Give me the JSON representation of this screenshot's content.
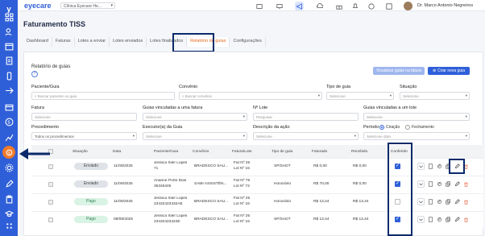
{
  "app": {
    "logo": "eyecare",
    "clinic": "Clínica Eyecare He...",
    "user": "Dr. Marco Antonio Negreiros"
  },
  "page": {
    "title": "Faturamento TISS"
  },
  "tabs": [
    {
      "label": "Dashboard"
    },
    {
      "label": "Faturas"
    },
    {
      "label": "Lotes a enviar"
    },
    {
      "label": "Lotes enviados"
    },
    {
      "label": "Lotes finalizados"
    },
    {
      "label": "Relatório de guias"
    },
    {
      "label": "Configurações"
    }
  ],
  "report": {
    "section_title": "Relatório de guias",
    "btn_view": "Visualizar guias na fatura",
    "btn_create": "Criar nova guia"
  },
  "filters": {
    "paciente": {
      "label": "Paciente/Guia",
      "placeholder": "Buscar paciente ou guia"
    },
    "convenio": {
      "label": "Convênio",
      "placeholder": "Buscar convênio"
    },
    "tipo": {
      "label": "Tipo de guia",
      "placeholder": "Selecione"
    },
    "situacao": {
      "label": "Situação",
      "placeholder": "Selecione"
    },
    "fatura": {
      "label": "Fatura",
      "placeholder": "Selecione"
    },
    "guias_fatura": {
      "label": "Guias vinculadas a uma fatura",
      "placeholder": "Selecione"
    },
    "lote": {
      "label": "Nº Lote",
      "placeholder": "Pesquisar"
    },
    "guias_lote": {
      "label": "Guias vinculadas a um lote",
      "placeholder": "Selecione"
    },
    "procedimento": {
      "label": "Procedimento",
      "placeholder": "Todos os procedimentos"
    },
    "executor": {
      "label": "Executor(a) da Guia",
      "placeholder": "Selecione"
    },
    "descricao": {
      "label": "Descrição da ação",
      "placeholder": "Selecione"
    },
    "periodo": {
      "label": "Período",
      "opt_criacao": "Criação",
      "opt_fechamento": "Fechamento",
      "placeholder": "Selecione data"
    }
  },
  "table": {
    "headers": {
      "situacao": "Situação",
      "data": "Data",
      "paciente": "Paciente/Guia",
      "convenio": "Convênio",
      "fatura": "Fatura/Lote",
      "tipo": "Tipo de guia",
      "faturado": "Faturado",
      "recebido": "Recebido",
      "conferido": "Conferido"
    },
    "rows": [
      {
        "status": "Enviado",
        "status_kind": "env",
        "date": "11/09/2025",
        "patient": "Jessica Xiler Lopes",
        "guide": "71",
        "convenio": "BRADESCO SAU...",
        "fat": "Fat Nº 25",
        "lote": "Lot Nº 15",
        "tipo": "SP/SADT",
        "faturado": "R$ 0,00",
        "recebido": "R$ 0,00",
        "conferido": true
      },
      {
        "status": "Enviado",
        "status_kind": "env",
        "date": "11/09/2025",
        "patient": "Arianne Porto Dias",
        "guide": "35345345",
        "convenio": "SAMI ASSISTÊN...",
        "fat": "Fat Nº 75",
        "lote": "Lot Nº 72",
        "tipo": "Honorário",
        "faturado": "R$ 70,00",
        "recebido": "R$ 0,00",
        "conferido": true
      },
      {
        "status": "Pago",
        "status_kind": "pago",
        "date": "11/09/2025",
        "patient": "Jessica Xiler Lopes",
        "guide": "23432423432AE",
        "convenio": "BRADESCO SAU...",
        "fat": "Fat Nº 25",
        "lote": "Lot Nº 16",
        "tipo": "Honorário",
        "faturado": "R$ 13,44",
        "recebido": "R$ 13,44",
        "conferido": false
      },
      {
        "status": "Pago",
        "status_kind": "pago",
        "date": "08/08/2025",
        "patient": "Jessica Xiler Lopes",
        "guide": "23432423424E",
        "convenio": "BRADESCO SAU...",
        "fat": "Fat Nº 25",
        "lote": "Lot Nº 15",
        "tipo": "SP/SADT",
        "faturado": "R$ 13,44",
        "recebido": "R$ 13,44",
        "conferido": true
      }
    ]
  }
}
